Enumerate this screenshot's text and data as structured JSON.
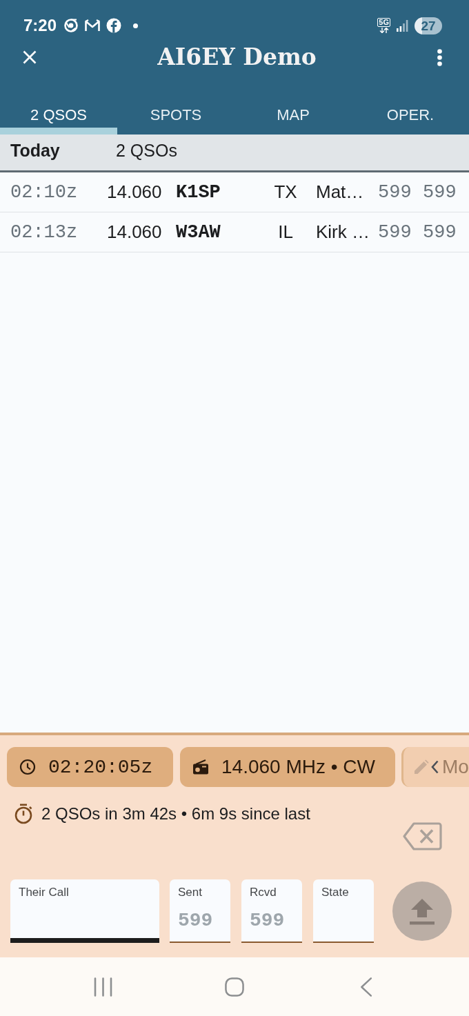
{
  "status_bar": {
    "time": "7:20",
    "network": "5G",
    "battery": "27"
  },
  "app_bar": {
    "title": "AI6EY Demo"
  },
  "tabs": [
    {
      "label": "2 QSOS",
      "selected": true
    },
    {
      "label": "SPOTS",
      "selected": false
    },
    {
      "label": "MAP",
      "selected": false
    },
    {
      "label": "OPER.",
      "selected": false
    }
  ],
  "section": {
    "title": "Today",
    "count": "2 QSOs"
  },
  "qsos": [
    {
      "time": "02:10z",
      "freq": "14.060",
      "call": "K1SP",
      "state": "TX",
      "name": "Mat…",
      "sent": "599",
      "rcvd": "599"
    },
    {
      "time": "02:13z",
      "freq": "14.060",
      "call": "W3AW",
      "state": "IL",
      "name": "Kirk …",
      "sent": "599",
      "rcvd": "599"
    }
  ],
  "panel": {
    "chips": [
      {
        "kind": "clock",
        "text": "02:20:05z",
        "disabled": false
      },
      {
        "kind": "radio",
        "text": "14.060 MHz • CW",
        "disabled": false
      },
      {
        "kind": "edit",
        "text": "Mo",
        "disabled": true
      }
    ],
    "stats": "2 QSOs in 3m 42s • 6m 9s since last",
    "fields": [
      {
        "label": "Their Call",
        "focused": true
      },
      {
        "label": "Sent",
        "placeholder": "599",
        "focused": false
      },
      {
        "label": "Rcvd",
        "placeholder": "599",
        "focused": false
      },
      {
        "label": "State",
        "focused": false
      }
    ]
  }
}
